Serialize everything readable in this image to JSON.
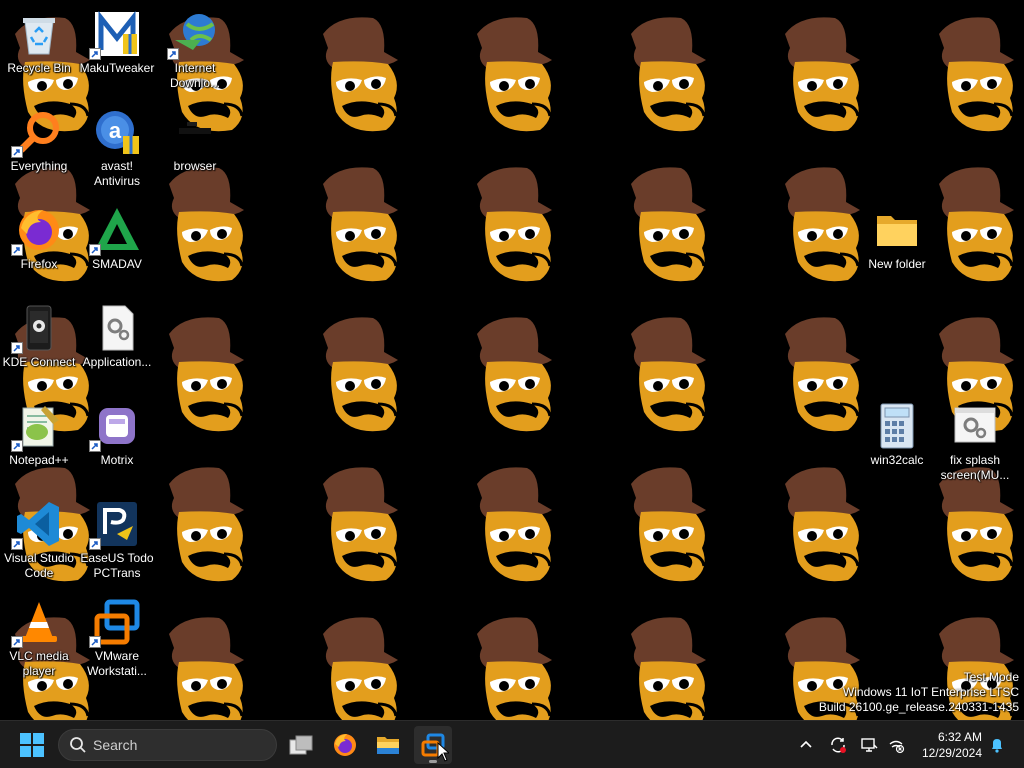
{
  "desktop": {
    "icons": [
      {
        "label": "Recycle Bin",
        "icon": "recycle-bin-icon"
      },
      {
        "label": "MakuTweaker",
        "icon": "makutweaker-icon"
      },
      {
        "label": "Internet Downlo...",
        "icon": "internet-download-manager-icon"
      },
      {
        "label": "Everything",
        "icon": "everything-search-icon"
      },
      {
        "label": "avast! Antivirus",
        "icon": "avast-icon"
      },
      {
        "label": "browser",
        "icon": "browser-icon"
      },
      {
        "label": "Firefox",
        "icon": "firefox-icon"
      },
      {
        "label": "SMADAV",
        "icon": "smadav-icon"
      },
      {
        "label": "New folder",
        "icon": "folder-icon"
      },
      {
        "label": "KDE Connect",
        "icon": "kde-connect-icon"
      },
      {
        "label": "Application...",
        "icon": "application-icon"
      },
      {
        "label": "Notepad++",
        "icon": "notepad-plus-plus-icon"
      },
      {
        "label": "Motrix",
        "icon": "motrix-icon"
      },
      {
        "label": "win32calc",
        "icon": "calculator-icon"
      },
      {
        "label": "fix splash screen(MU...",
        "icon": "settings-file-icon"
      },
      {
        "label": "Visual Studio Code",
        "icon": "vscode-icon"
      },
      {
        "label": "EaseUS Todo PCTrans",
        "icon": "easeus-todo-pctrans-icon"
      },
      {
        "label": "VLC media player",
        "icon": "vlc-icon"
      },
      {
        "label": "VMware Workstati...",
        "icon": "vmware-icon"
      }
    ]
  },
  "watermark": {
    "line1": "Test Mode",
    "line2": "Windows 11 IoT Enterprise LTSC",
    "line3": "Build 26100.ge_release.240331-1435"
  },
  "taskbar": {
    "search_placeholder": "Search",
    "pinned": [
      "start-icon",
      "task-view-icon",
      "firefox-icon",
      "file-explorer-icon",
      "vmware-icon"
    ],
    "active_app": "vmware-icon",
    "tray_icons": [
      "chevron-up-icon",
      "sync-icon",
      "display-icon",
      "network-disconnected-icon",
      "notification-bell-icon"
    ],
    "time": "6:32 AM",
    "date": "12/29/2024"
  }
}
